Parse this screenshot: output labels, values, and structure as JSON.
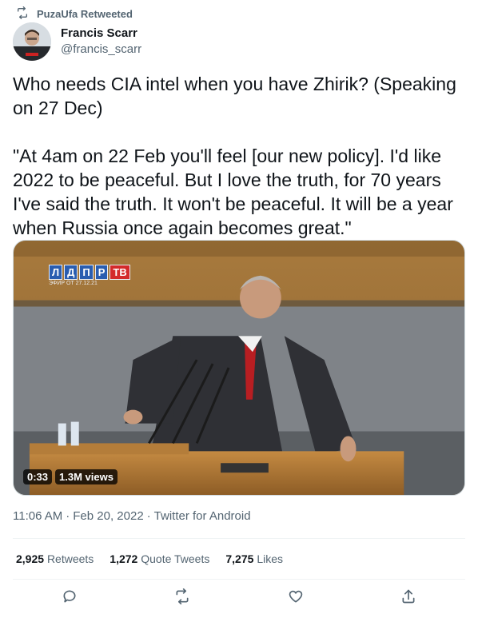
{
  "retweet": {
    "label": "PuzaUfa Retweeted"
  },
  "author": {
    "display_name": "Francis Scarr",
    "handle": "@francis_scarr"
  },
  "tweet": {
    "paragraphs": [
      "Who needs CIA intel when you have Zhirik? (Speaking on 27 Dec)",
      "\"At 4am on 22 Feb you'll feel [our new policy]. I'd like 2022 to be peaceful. But I love the truth, for 70 years I've said the truth. It won't be peaceful. It will be a year when Russia once again becomes great.\""
    ]
  },
  "media": {
    "channel_letters": [
      "Л",
      "Д",
      "П",
      "Р"
    ],
    "channel_tv": "ТВ",
    "channel_date": "ЭФИР ОТ 27.12.21",
    "duration": "0:33",
    "views": "1.3M views"
  },
  "meta": {
    "time": "11:06 AM",
    "date": "Feb 20, 2022",
    "source": "Twitter for Android",
    "separator": "·"
  },
  "stats": [
    {
      "count": "2,925",
      "label": "Retweets"
    },
    {
      "count": "1,272",
      "label": "Quote Tweets"
    },
    {
      "count": "7,275",
      "label": "Likes"
    }
  ],
  "actions": [
    "reply-icon",
    "retweet-icon",
    "like-icon",
    "share-icon"
  ],
  "colors": {
    "text": "#0f1419",
    "muted": "#536471",
    "border": "#eff3f4",
    "channel_blue": "#2a5db0",
    "channel_red": "#d42a2a"
  }
}
